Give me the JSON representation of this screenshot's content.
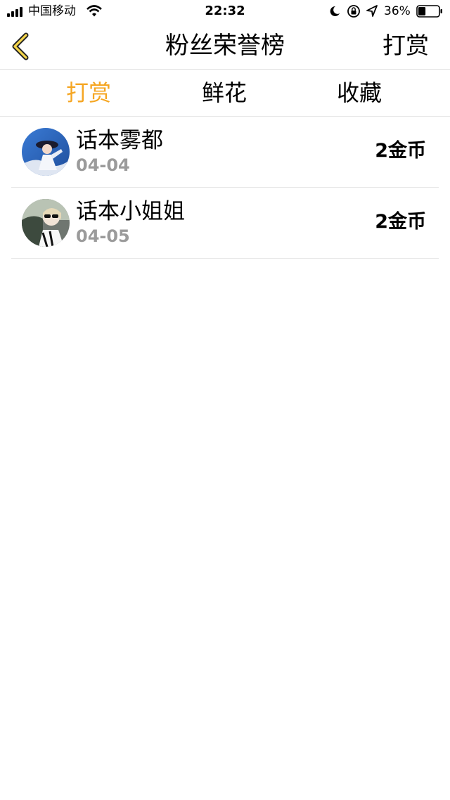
{
  "status_bar": {
    "carrier": "中国移动",
    "time": "22:32",
    "battery_percent": "36%",
    "battery_level": 0.36,
    "icons": [
      "signal-icon",
      "wifi-icon",
      "moon-icon",
      "orientation-lock-icon",
      "location-arrow-icon",
      "battery-icon"
    ]
  },
  "nav": {
    "back_icon": "chevron-left-icon",
    "title": "粉丝荣誉榜",
    "action": "打赏"
  },
  "tabs": [
    {
      "label": "打赏",
      "active": true
    },
    {
      "label": "鲜花",
      "active": false
    },
    {
      "label": "收藏",
      "active": false
    }
  ],
  "colors": {
    "accent": "#f5a623",
    "secondary_text": "#9b9b9b",
    "divider": "#e6e6e6"
  },
  "fans": [
    {
      "name": "话本雾都",
      "date": "04-04",
      "amount": "2金币",
      "avatar_icon": "avatar-image"
    },
    {
      "name": "话本小姐姐",
      "date": "04-05",
      "amount": "2金币",
      "avatar_icon": "avatar-image"
    }
  ]
}
